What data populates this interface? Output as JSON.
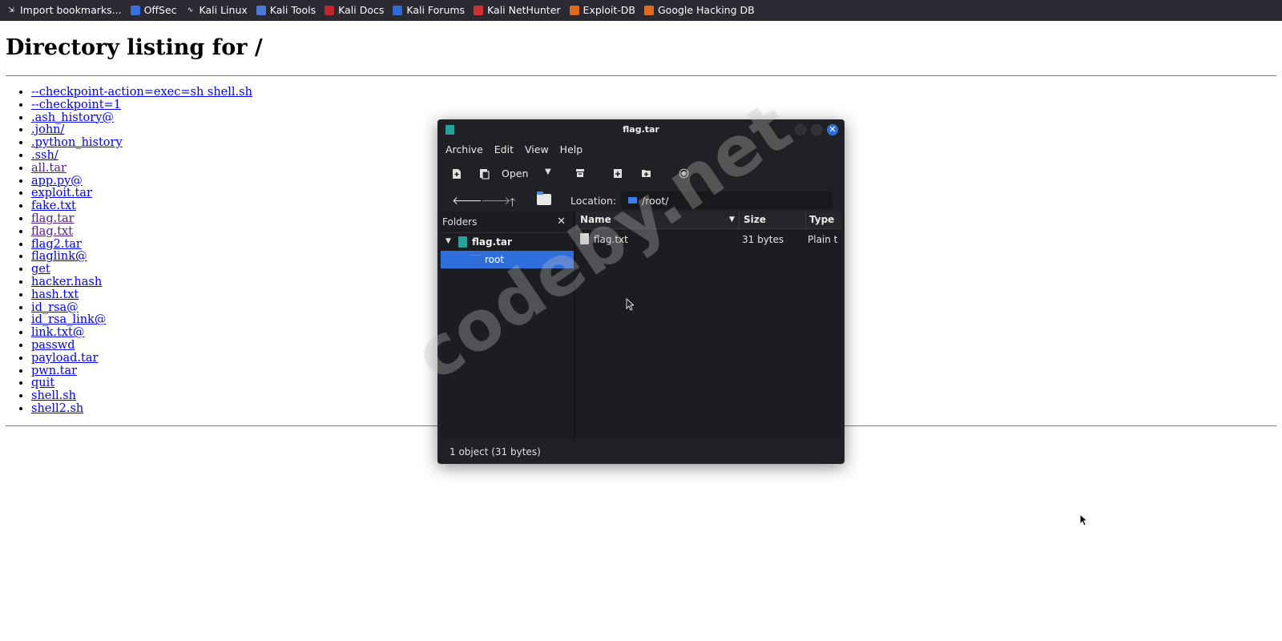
{
  "bookmarks": [
    {
      "label": "Import bookmarks...",
      "icon": "import-icon"
    },
    {
      "label": "OffSec",
      "icon": "offsec-icon"
    },
    {
      "label": "Kali Linux",
      "icon": "kali-dragon-icon"
    },
    {
      "label": "Kali Tools",
      "icon": "kali-tools-icon"
    },
    {
      "label": "Kali Docs",
      "icon": "kali-docs-icon"
    },
    {
      "label": "Kali Forums",
      "icon": "kali-forums-icon"
    },
    {
      "label": "Kali NetHunter",
      "icon": "nethunter-icon"
    },
    {
      "label": "Exploit-DB",
      "icon": "exploitdb-icon"
    },
    {
      "label": "Google Hacking DB",
      "icon": "ghdb-icon"
    }
  ],
  "page": {
    "heading": "Directory listing for /",
    "files": [
      {
        "name": "--checkpoint-action=exec=sh shell.sh",
        "visited": false
      },
      {
        "name": "--checkpoint=1",
        "visited": false
      },
      {
        "name": ".ash_history@",
        "visited": false
      },
      {
        "name": ".john/",
        "visited": false
      },
      {
        "name": ".python_history",
        "visited": false
      },
      {
        "name": ".ssh/",
        "visited": false
      },
      {
        "name": "all.tar",
        "visited": true
      },
      {
        "name": "app.py@",
        "visited": false
      },
      {
        "name": "exploit.tar",
        "visited": false
      },
      {
        "name": "fake.txt",
        "visited": false
      },
      {
        "name": "flag.tar",
        "visited": true
      },
      {
        "name": "flag.txt",
        "visited": true
      },
      {
        "name": "flag2.tar",
        "visited": false
      },
      {
        "name": "flaglink@",
        "visited": false
      },
      {
        "name": "get",
        "visited": false
      },
      {
        "name": "hacker.hash",
        "visited": false
      },
      {
        "name": "hash.txt",
        "visited": false
      },
      {
        "name": "id_rsa@",
        "visited": false
      },
      {
        "name": "id_rsa_link@",
        "visited": false
      },
      {
        "name": "link.txt@",
        "visited": false
      },
      {
        "name": "passwd",
        "visited": false
      },
      {
        "name": "payload.tar",
        "visited": false
      },
      {
        "name": "pwn.tar",
        "visited": false
      },
      {
        "name": "quit",
        "visited": false
      },
      {
        "name": "shell.sh",
        "visited": false
      },
      {
        "name": "shell2.sh",
        "visited": false
      }
    ]
  },
  "archive_window": {
    "title": "flag.tar",
    "menu": [
      "Archive",
      "Edit",
      "View",
      "Help"
    ],
    "toolbar": {
      "open_label": "Open"
    },
    "location_label": "Location:",
    "location_value": "/root/",
    "folders_header": "Folders",
    "tree": {
      "archive": "flag.tar",
      "selected_folder": "root"
    },
    "columns": [
      "Name",
      "Size",
      "Type"
    ],
    "files": [
      {
        "name": "flag.txt",
        "size": "31 bytes",
        "type": "Plain t"
      }
    ],
    "status": "1 object (31 bytes)"
  },
  "watermark": "codeby.net",
  "colors": {
    "bookmark_bar": "#2b2a33",
    "window_bg": "#202125",
    "selection": "#2f6fdc",
    "link": "#0000ee",
    "visited_link": "#551a8b"
  }
}
